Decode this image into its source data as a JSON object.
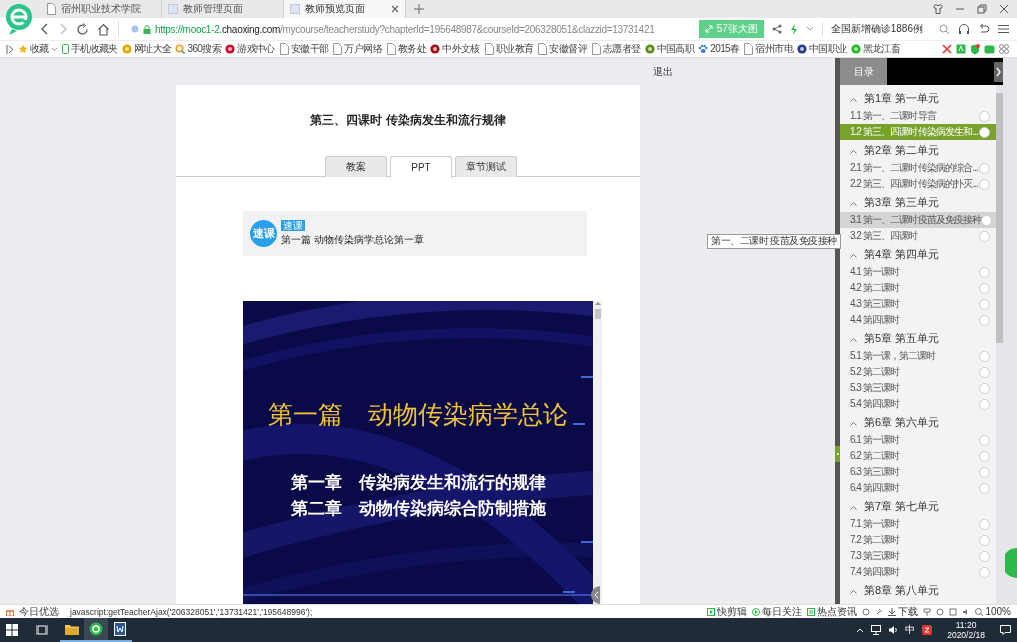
{
  "browser_tabs": [
    {
      "title": "宿州职业技术学院",
      "selected": false
    },
    {
      "title": "教师管理页面",
      "selected": false
    },
    {
      "title": "教师预览页面",
      "selected": true
    }
  ],
  "address": {
    "scheme": "https://mooc1-2.",
    "domain": "chaoxing.com",
    "path": "/mycourse/teacherstudy?chapterId=195648987&courseId=206328051&clazzid=13731421"
  },
  "image_button": "57张大图",
  "news": "全国新增确诊1886例",
  "bookmarks": [
    {
      "label": "收藏",
      "kind": "star"
    },
    {
      "label": "手机收藏夹",
      "kind": "phone"
    },
    {
      "label": "网址大全",
      "kind": "site",
      "color": "#e0a800"
    },
    {
      "label": "360搜索",
      "kind": "search"
    },
    {
      "label": "游戏中心",
      "kind": "site",
      "color": "#c8102e"
    },
    {
      "label": "安徽干部",
      "kind": "page"
    },
    {
      "label": "万户网络",
      "kind": "page"
    },
    {
      "label": "教务处",
      "kind": "page"
    },
    {
      "label": "中外文核",
      "kind": "site",
      "color": "#a01010"
    },
    {
      "label": "职业教育",
      "kind": "page"
    },
    {
      "label": "安徽督评",
      "kind": "page"
    },
    {
      "label": "志愿者登",
      "kind": "page"
    },
    {
      "label": "中国高职",
      "kind": "site",
      "color": "#5a8a1a"
    },
    {
      "label": "2015春",
      "kind": "paw"
    },
    {
      "label": "宿州市电",
      "kind": "page"
    },
    {
      "label": "中国职业",
      "kind": "site",
      "color": "#2a3a8a"
    },
    {
      "label": "黑龙江畜",
      "kind": "site",
      "color": "#18c018"
    }
  ],
  "logout": "退出",
  "course": {
    "title": "第三、四课时 传染病发生和流行规律",
    "tabs": [
      {
        "label": "教案",
        "selected": false
      },
      {
        "label": "PPT",
        "selected": true
      },
      {
        "label": "章节测试",
        "selected": false
      }
    ],
    "video_badge": "速课",
    "video_tag": "速课",
    "video_title": "第一篇 动物传染病学总论第一章",
    "slide": {
      "heading": "第一篇　动物传染病学总论",
      "lines": [
        "第一章　传染病发生和流行的规律",
        "第二章　动物传染病综合防制措施"
      ]
    }
  },
  "toc": {
    "title": "目录",
    "tooltip": "第一、二课时  疫苗及免疫接种",
    "chapters": [
      {
        "title": "第1章 第一单元",
        "expanded": true,
        "children": [
          {
            "title": "1.1 第一、二课时 导言",
            "selected": false,
            "hovered": false
          },
          {
            "title": "1.2 第三、四课时 传染病发生和...",
            "selected": true,
            "hovered": false
          }
        ]
      },
      {
        "title": "第2章 第二单元",
        "expanded": true,
        "children": [
          {
            "title": "2.1 第一、二课时 传染病的综合...",
            "selected": false,
            "hovered": false
          },
          {
            "title": "2.2 第三、四课时 传染病的扑灭...",
            "selected": false,
            "hovered": false
          }
        ]
      },
      {
        "title": "第3章 第三单元",
        "expanded": true,
        "children": [
          {
            "title": "3.1 第一、二课时 疫苗及免疫接种",
            "selected": false,
            "hovered": true
          },
          {
            "title": "3.2 第三、四课时",
            "selected": false,
            "hovered": false
          }
        ]
      },
      {
        "title": "第4章 第四单元",
        "expanded": true,
        "children": [
          {
            "title": "4.1 第一课时",
            "selected": false,
            "hovered": false
          },
          {
            "title": "4.2 第二课时",
            "selected": false,
            "hovered": false
          },
          {
            "title": "4.3 第三课时",
            "selected": false,
            "hovered": false
          },
          {
            "title": "4.4 第四课时",
            "selected": false,
            "hovered": false
          }
        ]
      },
      {
        "title": "第5章 第五单元",
        "expanded": true,
        "children": [
          {
            "title": "5.1 第一课，第二课时",
            "selected": false,
            "hovered": false
          },
          {
            "title": "5.2 第二课时",
            "selected": false,
            "hovered": false
          },
          {
            "title": "5.3 第三课时",
            "selected": false,
            "hovered": false
          },
          {
            "title": "5.4 第四课时",
            "selected": false,
            "hovered": false
          }
        ]
      },
      {
        "title": "第6章 第六单元",
        "expanded": true,
        "children": [
          {
            "title": "6.1 第一课时",
            "selected": false,
            "hovered": false
          },
          {
            "title": "6.2 第二课时",
            "selected": false,
            "hovered": false
          },
          {
            "title": "6.3 第三课时",
            "selected": false,
            "hovered": false
          },
          {
            "title": "6.4 第四课时",
            "selected": false,
            "hovered": false
          }
        ]
      },
      {
        "title": "第7章 第七单元",
        "expanded": true,
        "children": [
          {
            "title": "7.1 第一课时",
            "selected": false,
            "hovered": false
          },
          {
            "title": "7.2 第二课时",
            "selected": false,
            "hovered": false
          },
          {
            "title": "7.3 第三课时",
            "selected": false,
            "hovered": false
          },
          {
            "title": "7.4 第四课时",
            "selected": false,
            "hovered": false
          }
        ]
      },
      {
        "title": "第8章 第八单元",
        "expanded": true
      }
    ]
  },
  "status_bar": {
    "left": "今日优选",
    "link": "javascript:getTeacherAjax('206328051','13731421','195648996');",
    "right": [
      {
        "label": "快剪辑"
      },
      {
        "label": "每日关注"
      },
      {
        "label": "热点资讯"
      }
    ],
    "download": "下载",
    "zoom": "100%"
  },
  "taskbar": {
    "ime": "中",
    "time": "11:20",
    "date": "2020/2/18"
  }
}
